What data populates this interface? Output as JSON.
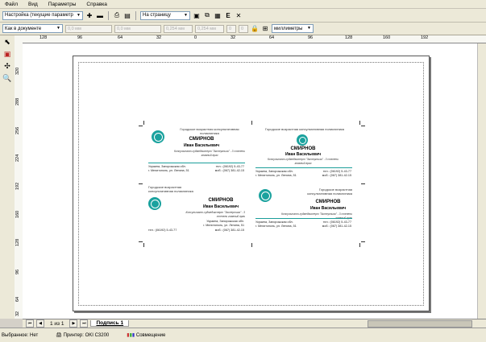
{
  "menu": [
    "Файл",
    "Вид",
    "Параметры",
    "Справка"
  ],
  "toolbar1": {
    "preset_combo": "Настройка (текущие параметр",
    "fit_combo": "На страницу"
  },
  "toolbar2": {
    "doc_combo": "Как в документе",
    "field1": "0,0 мм",
    "field2": "0,0 мм",
    "field3": "0,254 мм",
    "field4": "0,254 мм",
    "field5": "0",
    "field6": "0",
    "units_combo": "миллиметры"
  },
  "ruler_top": [
    "128",
    "96",
    "64",
    "32",
    "0",
    "32",
    "64",
    "96",
    "128",
    "160",
    "192"
  ],
  "ruler_left": [
    "320",
    "288",
    "256",
    "224",
    "192",
    "160",
    "128",
    "96",
    "64",
    "32"
  ],
  "cards": {
    "org": "Городское возрастная консультативная поликлиника",
    "surname": "СМИРНОВ",
    "given": "Иван Васильевич",
    "position": "Консультант-судмедэксперт \"Экспертиза\" - 3 степени главный врач",
    "addr1": "Украина, Запорожская обл.",
    "addr2": "г. Мелитополь, ул. Ленина, 51",
    "tel1": "тел.: (06192) 5-43-77",
    "tel2": "моб.: (067) 381-42-15"
  },
  "tabs": {
    "page_count": "1 из 1",
    "page_tab": "Подпись 1"
  },
  "status": {
    "selected": "Выбранное: Нет",
    "printer": "Принтер: OKI C3200",
    "compat": "Совмещение"
  }
}
